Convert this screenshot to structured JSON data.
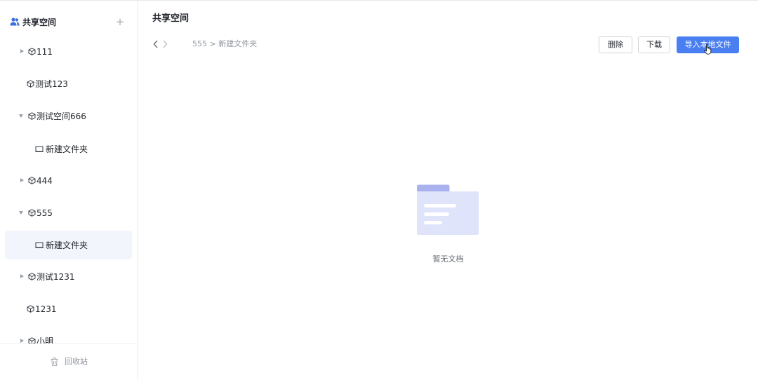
{
  "sidebar": {
    "title": "共享空间",
    "add_label": "+",
    "tree": [
      {
        "label": "111",
        "caret": "right",
        "icon": "cube-icon"
      },
      {
        "label": "测试123",
        "caret": "none",
        "icon": "cube-icon"
      },
      {
        "label": "测试空间666",
        "caret": "down",
        "icon": "cube-icon"
      },
      {
        "label": "新建文件夹",
        "caret": "none",
        "icon": "folder-icon",
        "child": true
      },
      {
        "label": "444",
        "caret": "right",
        "icon": "cube-icon"
      },
      {
        "label": "555",
        "caret": "down",
        "icon": "cube-icon"
      },
      {
        "label": "新建文件夹",
        "caret": "none",
        "icon": "folder-icon",
        "child": true,
        "selected": true
      },
      {
        "label": "测试1231",
        "caret": "right",
        "icon": "cube-icon"
      },
      {
        "label": "1231",
        "caret": "none",
        "icon": "cube-icon"
      },
      {
        "label": "小明",
        "caret": "right",
        "icon": "cube-icon"
      }
    ],
    "footer": {
      "trash_label": "回收站"
    }
  },
  "main": {
    "title": "共享空间",
    "breadcrumb": {
      "parent": "555",
      "separator": ">",
      "current": "新建文件夹"
    },
    "buttons": {
      "delete": "删除",
      "download": "下载",
      "import": "导入本地文件"
    },
    "empty_text": "暂无文档"
  },
  "colors": {
    "accent": "#4a7ff2",
    "selected_bg": "#f2f5fc",
    "illustration_light": "#dfe4fb",
    "illustration_dark": "#a9b1ef"
  }
}
